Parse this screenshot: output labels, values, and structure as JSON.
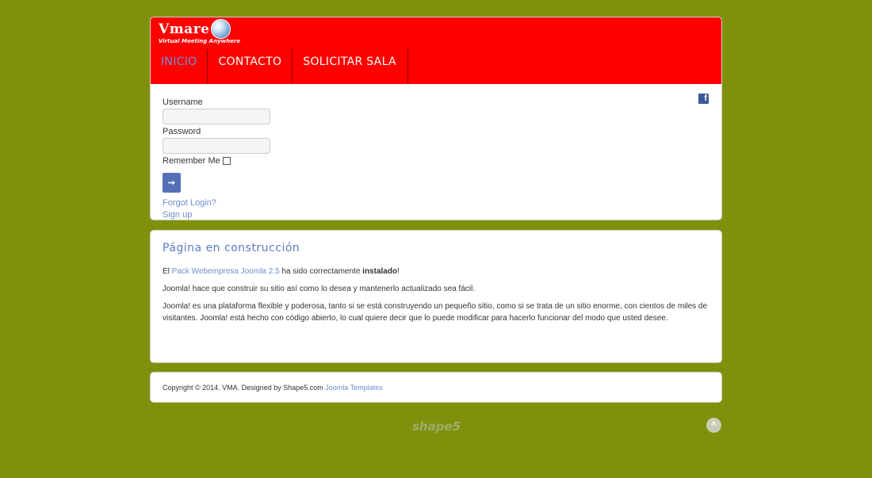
{
  "brand": {
    "title": "Vmare",
    "tagline": "Virtual Meeting Anywhere"
  },
  "nav": {
    "items": [
      {
        "label": "INICIO",
        "active": true
      },
      {
        "label": "CONTACTO",
        "active": false
      },
      {
        "label": "SOLICITAR SALA",
        "active": false
      }
    ]
  },
  "login": {
    "username_label": "Username",
    "password_label": "Password",
    "remember_label": "Remember Me",
    "submit_icon": "➙",
    "forgot_link": "Forgot Login?",
    "signup_link": "Sign up"
  },
  "social": {
    "facebook_glyph": "f"
  },
  "content": {
    "title": "Página en construcción",
    "p1_prefix": "El ",
    "p1_link": "Pack Webempresa Joomla 2.5",
    "p1_middle": " ha sido correctamente ",
    "p1_bold": "instalado",
    "p1_suffix": "!",
    "p2": "Joomla! hace que construir su sitio así como lo desea y mantenerlo actualizado sea fácil.",
    "p3": "Joomla! es una plataforma flexible y poderosa, tanto si se está construyendo un pequeño sitio, como si se trata de un sitio enorme, con cientos de miles de visitantes. Joomla! está hecho con código abierto, lo cual quiere decir que lo puede modificar para hacerlo funcionar del modo que usted desee."
  },
  "footer": {
    "copyright": "Copyright © 2014. VMA. Designed by Shape5.com ",
    "templates_link": "Joomla Templates",
    "shape5_logo": "shape5",
    "up_glyph": "˄"
  },
  "colors": {
    "background": "#7f910c",
    "header": "#ff0000",
    "link": "#6f8ccc",
    "active_nav": "#6f8ed8"
  },
  "icons": [
    "globe-icon",
    "facebook-icon",
    "login-arrow-icon",
    "scroll-up-icon"
  ]
}
